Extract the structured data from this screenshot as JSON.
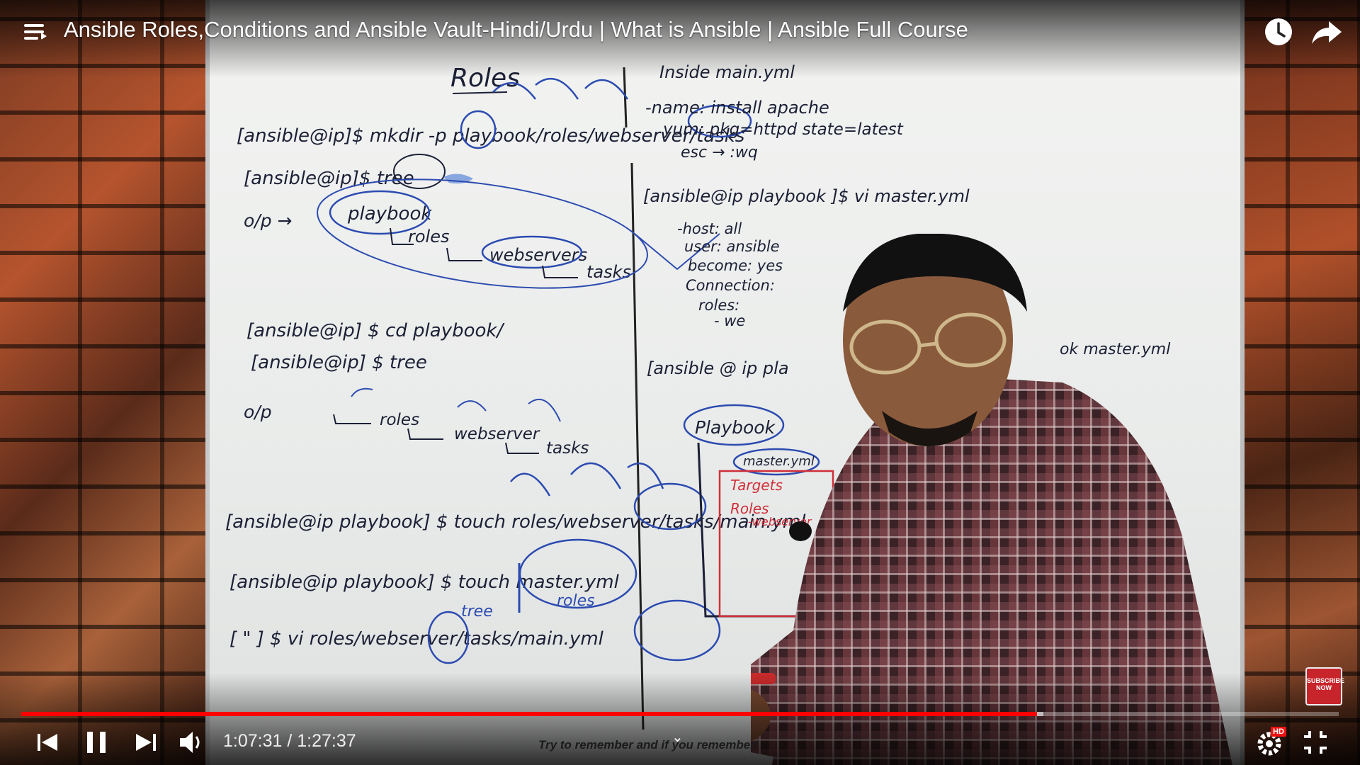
{
  "header": {
    "title": "Ansible Roles,Conditions and Ansible Vault-Hindi/Urdu | What is Ansible | Ansible Full Course"
  },
  "player": {
    "current_time": "1:07:31",
    "duration": "1:27:37",
    "time_separator": " / ",
    "progress_fraction": 0.771,
    "buffer_fraction": 0.776,
    "quality_badge": "HD",
    "subscribe_badge": "SUBSCRIBE NOW",
    "hint_text": "Try to remember and if you remember!"
  },
  "board": {
    "heading": "Roles",
    "left": [
      "[ansible@ip]$   mkdir  -p   playbook/roles/webserver/tasks",
      "[ansible@ip]$   tree",
      "o/p  →",
      "playbook",
      "roles",
      "webservers",
      "tasks",
      "[ansible@ip] $   cd   playbook/",
      "[ansible@ip] $   tree",
      "o/p",
      "roles",
      "webserver",
      "tasks",
      "[ansible@ip playbook] $  touch  roles/webserver/tasks/main.yml",
      "[ansible@ip playbook] $   touch  master.yml",
      "tree",
      "roles",
      "[          \"          ] $  vi  roles/webserver/tasks/main.yml"
    ],
    "right": [
      "Inside  main.yml",
      "-name:  install  apache",
      "yum:  pkg=httpd  state=latest",
      "esc → :wq",
      "[ansible@ip playbook ]$  vi  master.yml",
      "-host: all",
      "user: ansible",
      "become: yes",
      "Connection:",
      "roles:",
      "- we",
      "[ansible @ ip pla",
      "ok master.yml",
      "Playbook",
      "master.yml",
      "Targets",
      "Roles",
      "-webserver"
    ]
  },
  "colors": {
    "progress": "#ff0000",
    "ink": "#1c2036",
    "blue_marker": "#2c4bb0",
    "red_marker": "#d0303a"
  },
  "icons": {
    "menu": "menu-icon",
    "watch_later": "clock-icon",
    "share": "share-icon",
    "previous": "skip-previous-icon",
    "pause": "pause-icon",
    "next": "skip-next-icon",
    "volume": "volume-icon",
    "settings": "gear-icon",
    "exit_fullscreen": "exit-fullscreen-icon"
  }
}
